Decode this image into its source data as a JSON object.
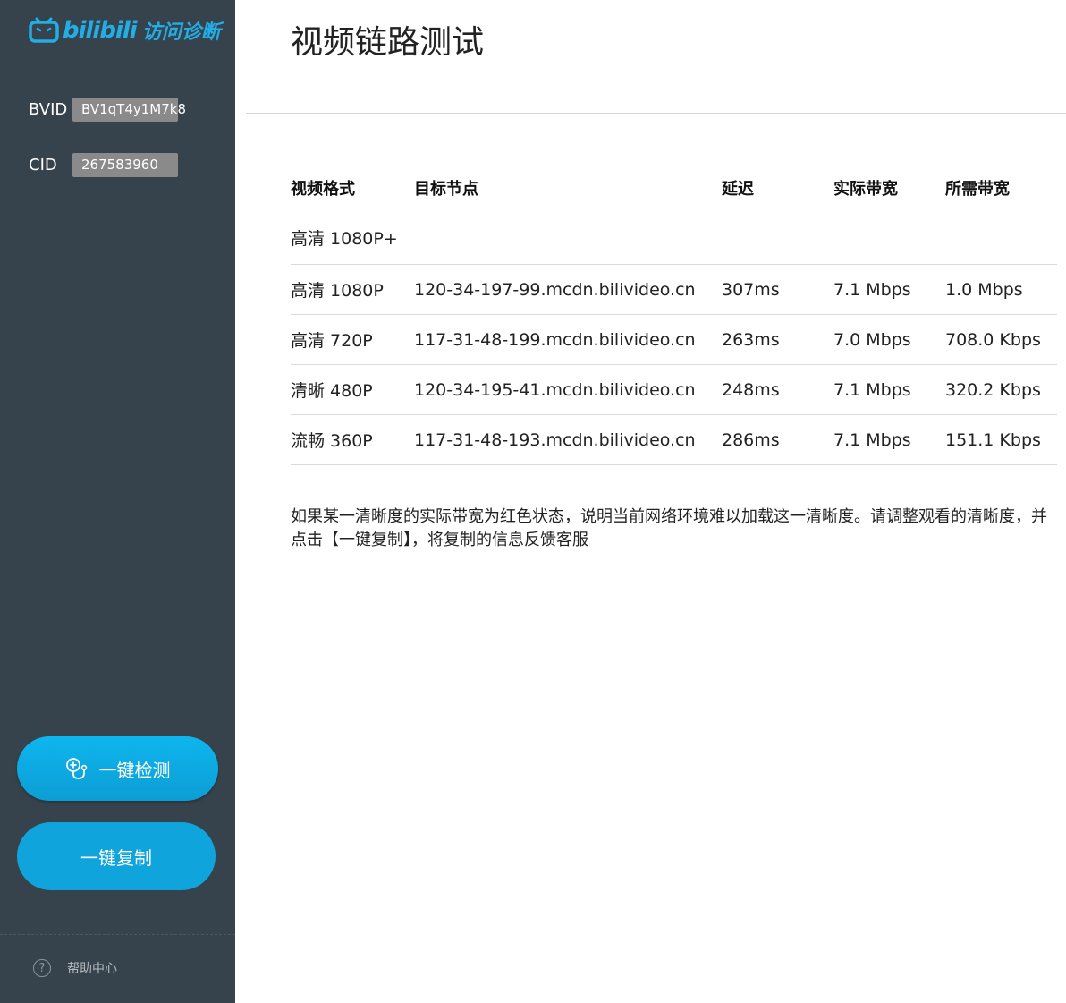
{
  "sidebar": {
    "logo_brand": "bilibili",
    "logo_subtitle": "访问诊断",
    "bvid_label": "BVID",
    "bvid_value": "BV1qT4y1M7k8",
    "cid_label": "CID",
    "cid_value": "267583960",
    "detect_button": "一键检测",
    "copy_button": "一键复制",
    "help_label": "帮助中心"
  },
  "main": {
    "title": "视频链路测试",
    "table": {
      "headers": [
        "视频格式",
        "目标节点",
        "延迟",
        "实际带宽",
        "所需带宽"
      ],
      "rows": [
        {
          "format": "高清 1080P+",
          "node": "",
          "latency": "",
          "actual": "",
          "required": ""
        },
        {
          "format": "高清 1080P",
          "node": "120-34-197-99.mcdn.bilivideo.cn",
          "latency": "307ms",
          "actual": "7.1 Mbps",
          "required": "1.0 Mbps"
        },
        {
          "format": "高清 720P",
          "node": "117-31-48-199.mcdn.bilivideo.cn",
          "latency": "263ms",
          "actual": "7.0 Mbps",
          "required": "708.0 Kbps"
        },
        {
          "format": "清晰 480P",
          "node": "120-34-195-41.mcdn.bilivideo.cn",
          "latency": "248ms",
          "actual": "7.1 Mbps",
          "required": "320.2 Kbps"
        },
        {
          "format": "流畅 360P",
          "node": "117-31-48-193.mcdn.bilivideo.cn",
          "latency": "286ms",
          "actual": "7.1 Mbps",
          "required": "151.1 Kbps"
        }
      ]
    },
    "note": "如果某一清晰度的实际带宽为红色状态，说明当前网络环境难以加载这一清晰度。请调整观看的清晰度，并点击【一键复制】，将复制的信息反馈客服"
  },
  "colors": {
    "sidebar_bg": "#36434d",
    "brand_blue": "#23ade5",
    "button_blue": "#0fa4dc",
    "bandwidth_ok": "#2e8b2e"
  },
  "icons": [
    "bilibili-tv-logo-icon",
    "stethoscope-icon",
    "help-circle-icon"
  ]
}
